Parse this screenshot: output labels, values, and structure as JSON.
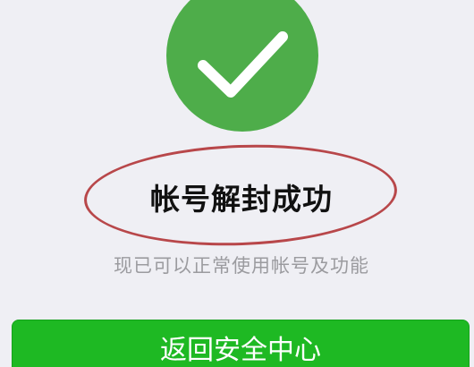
{
  "status": {
    "icon": "checkmark-icon",
    "color": "#4ead4a",
    "title": "帐号解封成功",
    "subtitle": "现已可以正常使用帐号及功能"
  },
  "annotation": {
    "shape": "ellipse",
    "color": "#b8474a"
  },
  "actions": {
    "primary_label": "返回安全中心",
    "primary_color": "#1eb923"
  }
}
